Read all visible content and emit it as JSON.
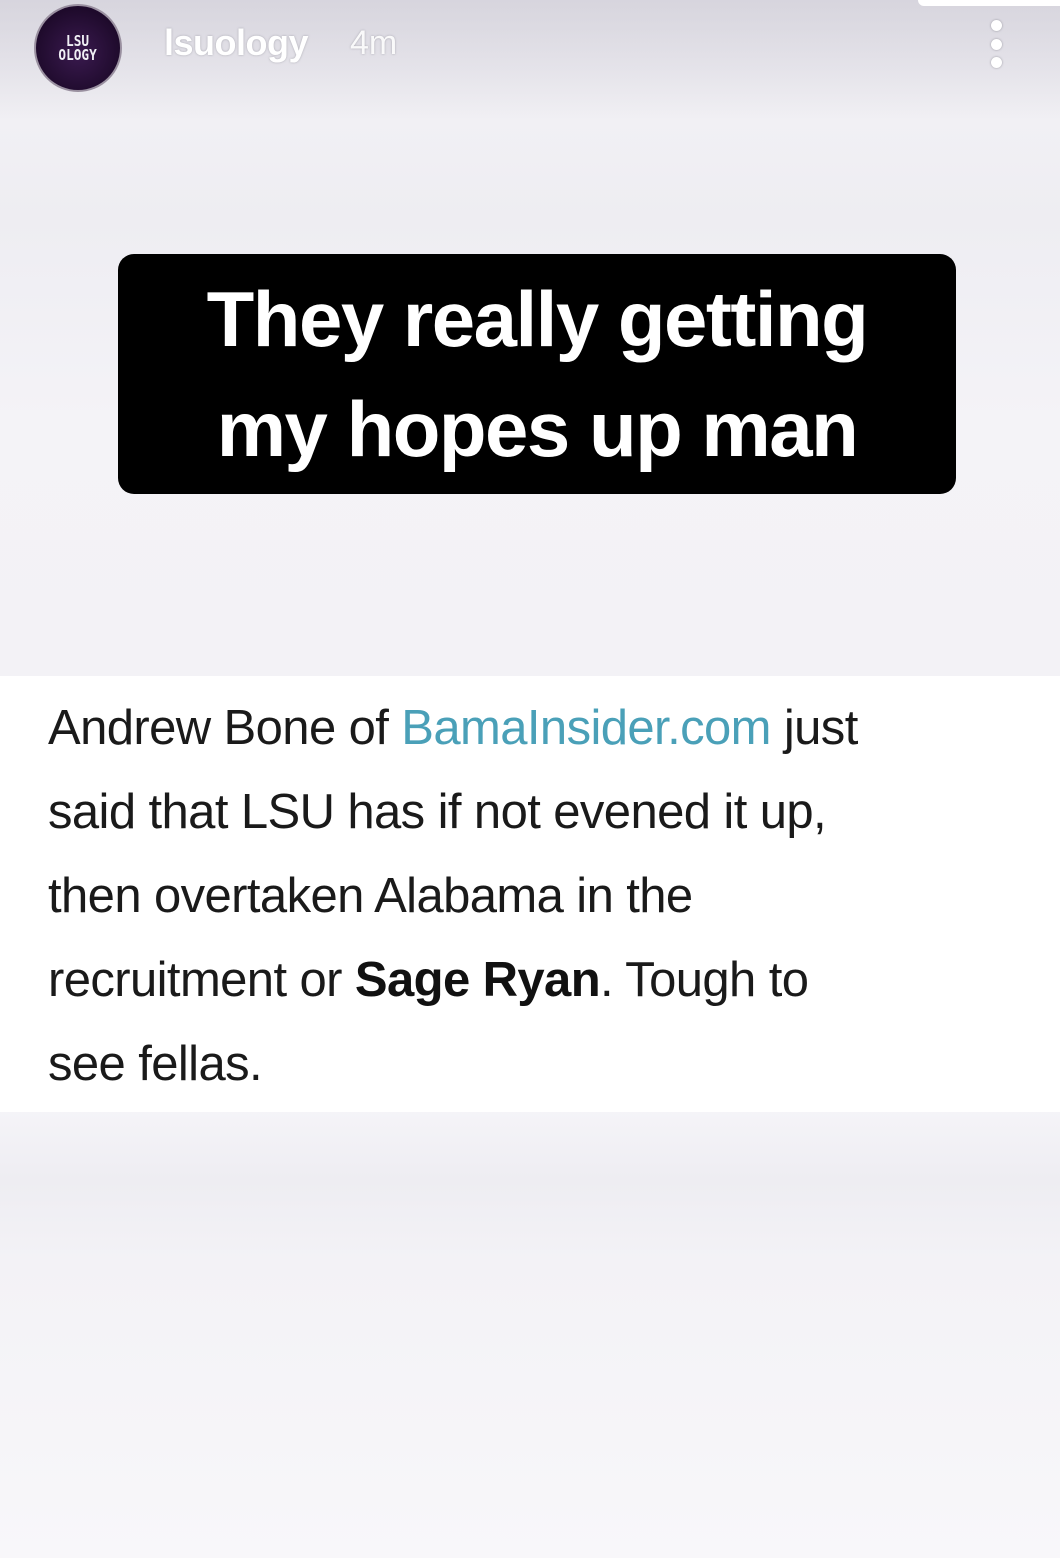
{
  "header": {
    "avatar_line1": "LSU",
    "avatar_line2": "OLOGY",
    "username": "lsuology",
    "timestamp": "4m"
  },
  "caption": {
    "line1": "They really getting",
    "line2": "my hopes up man"
  },
  "tweet": {
    "line1_pre": "Andrew Bone of ",
    "link": "BamaInsider.com",
    "line1_post": " just",
    "line2": "said that LSU has if not evened it up,",
    "line3": "then overtaken Alabama in the",
    "line4_pre": "recruitment or ",
    "line4_bold": "Sage Ryan",
    "line4_post": ". Tough to",
    "line5": "see fellas."
  },
  "colors": {
    "link": "#4aa0b8",
    "caption_bg": "#000000",
    "avatar_bg": "#1e0a2b"
  }
}
